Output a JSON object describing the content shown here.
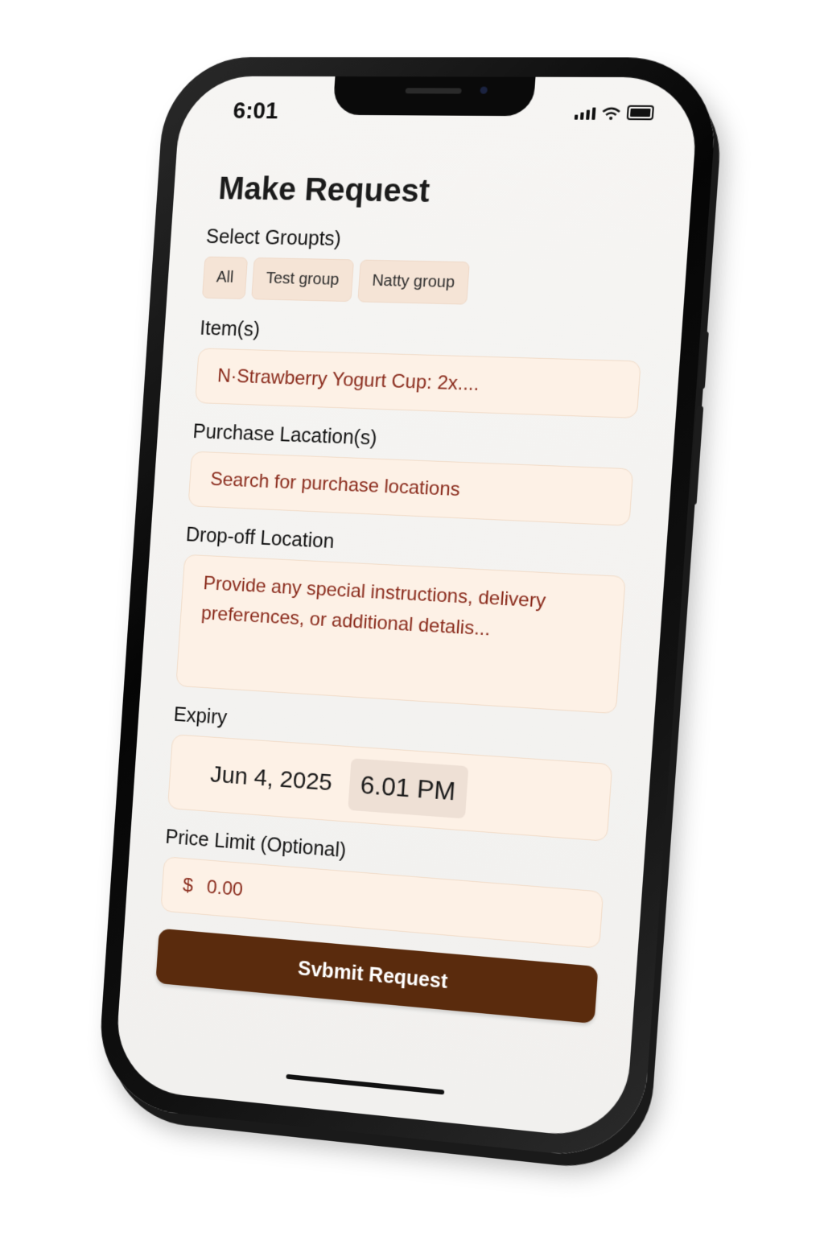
{
  "status_bar": {
    "time": "6:01",
    "signal_icon": "cellular-signal-icon",
    "wifi_icon": "wifi-icon",
    "battery_icon": "battery-icon"
  },
  "page": {
    "title": "Make Request"
  },
  "groups": {
    "label": "Select Groupts)",
    "chips": [
      "All",
      "Test group",
      "Natty group"
    ]
  },
  "items": {
    "label": "Item(s)",
    "value": "N·Strawberry Yogurt Cup: 2x...."
  },
  "purchase_locations": {
    "label": "Purchase Lacation(s)",
    "placeholder": "Search for purchase locations"
  },
  "dropoff": {
    "label": "Drop-off Location",
    "placeholder": "Provide any special instructions, delivery preferences, or additional detalis..."
  },
  "expiry": {
    "label": "Expiry",
    "date": "Jun 4, 2025",
    "time": "6.01 PM"
  },
  "price_limit": {
    "label": "Price Limit (Optional)",
    "currency": "$",
    "value": "0.00"
  },
  "submit": {
    "label": "Svbmit Request"
  },
  "colors": {
    "accent": "#5a2b0d",
    "field_bg": "#fdf1e6",
    "chip_bg": "#f5e4d6",
    "placeholder_text": "#8a2b1c"
  }
}
